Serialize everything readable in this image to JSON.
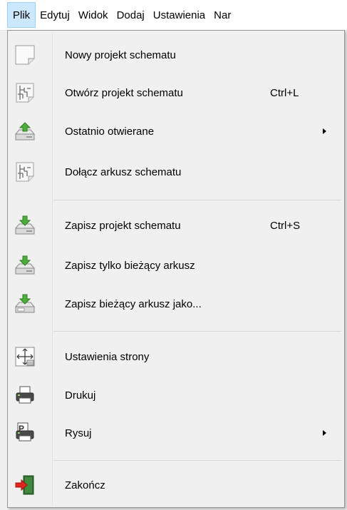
{
  "menubar": {
    "items": [
      "Plik",
      "Edytuj",
      "Widok",
      "Dodaj",
      "Ustawienia",
      "Nar"
    ]
  },
  "menu": {
    "items": [
      {
        "label": "Nowy projekt schematu",
        "shortcut": "",
        "icon": "new-document-icon"
      },
      {
        "label": "Otwórz projekt schematu",
        "shortcut": "Ctrl+L",
        "icon": "schematic-icon"
      },
      {
        "label": "Ostatnio otwierane",
        "shortcut": "",
        "icon": "drive-up-icon",
        "submenu": true
      },
      {
        "label": "Dołącz arkusz schematu",
        "shortcut": "",
        "icon": "schematic-icon"
      },
      {
        "label": "Zapisz projekt schematu",
        "shortcut": "Ctrl+S",
        "icon": "drive-down-icon"
      },
      {
        "label": "Zapisz tylko bieżący arkusz",
        "shortcut": "",
        "icon": "drive-down-icon"
      },
      {
        "label": "Zapisz bieżący arkusz jako...",
        "shortcut": "",
        "icon": "drive-down-icon"
      },
      {
        "label": "Ustawienia strony",
        "shortcut": "",
        "icon": "page-setup-icon"
      },
      {
        "label": "Drukuj",
        "shortcut": "",
        "icon": "printer-icon"
      },
      {
        "label": "Rysuj",
        "shortcut": "",
        "icon": "plot-icon",
        "submenu": true
      },
      {
        "label": "Zakończ",
        "shortcut": "",
        "icon": "exit-icon"
      }
    ]
  },
  "colors": {
    "active_menu_bg": "#cce8ff",
    "active_menu_border": "#99d1ff",
    "menu_bg": "#f0f0f0",
    "save_green": "#4caf3c",
    "exit_red": "#e0261c"
  }
}
